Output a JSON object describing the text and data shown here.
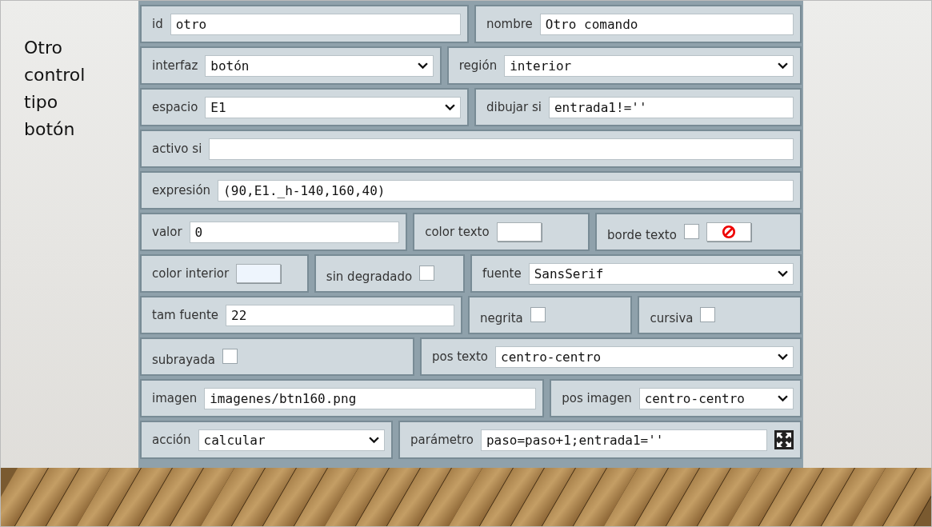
{
  "slide_title": "Otro control tipo botón",
  "rows": [
    [
      {
        "kind": "text",
        "label": "id",
        "value": "otro"
      },
      {
        "kind": "text",
        "label": "nombre",
        "value": "Otro comando"
      }
    ],
    [
      {
        "kind": "select",
        "label": "interfaz",
        "value": "botón"
      },
      {
        "kind": "select",
        "label": "región",
        "value": "interior"
      }
    ],
    [
      {
        "kind": "select",
        "label": "espacio",
        "value": "E1"
      },
      {
        "kind": "text",
        "label": "dibujar si",
        "value": "entrada1!=''"
      }
    ],
    [
      {
        "kind": "text",
        "label": "activo si"
      }
    ],
    [
      {
        "kind": "text",
        "label": "expresión",
        "value": "(90,E1._h-140,160,40)"
      }
    ],
    [
      {
        "kind": "text",
        "label": "valor",
        "value": "0"
      },
      {
        "kind": "color",
        "label": "color texto",
        "color": "#ffffff"
      },
      {
        "kind": "checkcolor",
        "label": "borde texto",
        "checked": false
      }
    ],
    [
      {
        "kind": "color",
        "label": "color interior",
        "color": "#eef5fd"
      },
      {
        "kind": "checkbox",
        "label": "sin degradado",
        "checked": false
      },
      {
        "kind": "select",
        "label": "fuente",
        "value": "SansSerif"
      }
    ],
    [
      {
        "kind": "text",
        "label": "tam fuente",
        "value": "22"
      },
      {
        "kind": "checkbox",
        "label": "negrita",
        "checked": false
      },
      {
        "kind": "checkbox",
        "label": "cursiva",
        "checked": false
      }
    ],
    [
      {
        "kind": "checkbox",
        "label": "subrayada",
        "checked": false
      },
      {
        "kind": "select",
        "label": "pos texto",
        "value": "centro-centro"
      }
    ],
    [
      {
        "kind": "text",
        "label": "imagen",
        "value": "imagenes/btn160.png"
      },
      {
        "kind": "select",
        "label": "pos imagen",
        "value": "centro-centro"
      }
    ],
    [
      {
        "kind": "select",
        "label": "acción",
        "value": "calcular"
      },
      {
        "kind": "expand",
        "label": "parámetro",
        "value": "paso=paso+1;entrada1=''"
      }
    ]
  ]
}
